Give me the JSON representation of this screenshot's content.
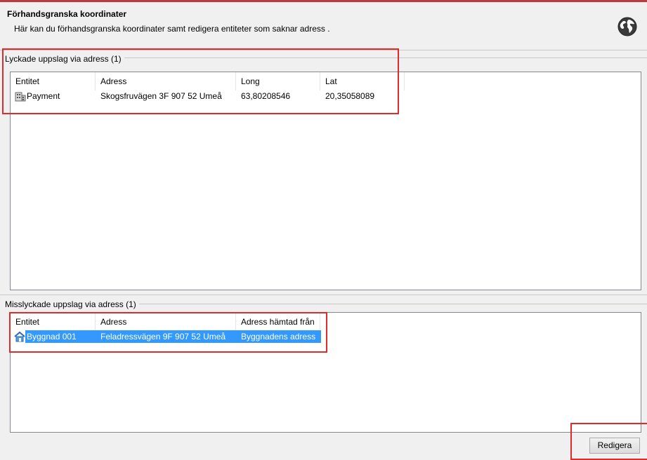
{
  "header": {
    "title": "Förhandsgranska koordinater",
    "description": "Här kan du förhandsgranska koordinater samt redigera entiteter som saknar adress ."
  },
  "success_group": {
    "label": "Lyckade uppslag via adress (1)",
    "columns": [
      "Entitet",
      "Adress",
      "Long",
      "Lat"
    ],
    "rows": [
      {
        "entity": "Payment",
        "address": "Skogsfruvägen 3F 907 52 Umeå",
        "long": "63,80208546",
        "lat": "20,35058089",
        "icon": "building-icon"
      }
    ]
  },
  "failed_group": {
    "label": "Misslyckade uppslag via adress  (1)",
    "columns": [
      "Entitet",
      "Adress",
      "Adress hämtad från"
    ],
    "rows": [
      {
        "entity": "Byggnad 001",
        "address": "Feladressvägen 9F 907 52 Umeå",
        "source": "Byggnadens adress",
        "icon": "house-icon",
        "selected": true
      }
    ]
  },
  "buttons": {
    "edit": "Redigera"
  },
  "colors": {
    "accent_red": "#e02b2b",
    "selection": "#3399ff"
  }
}
